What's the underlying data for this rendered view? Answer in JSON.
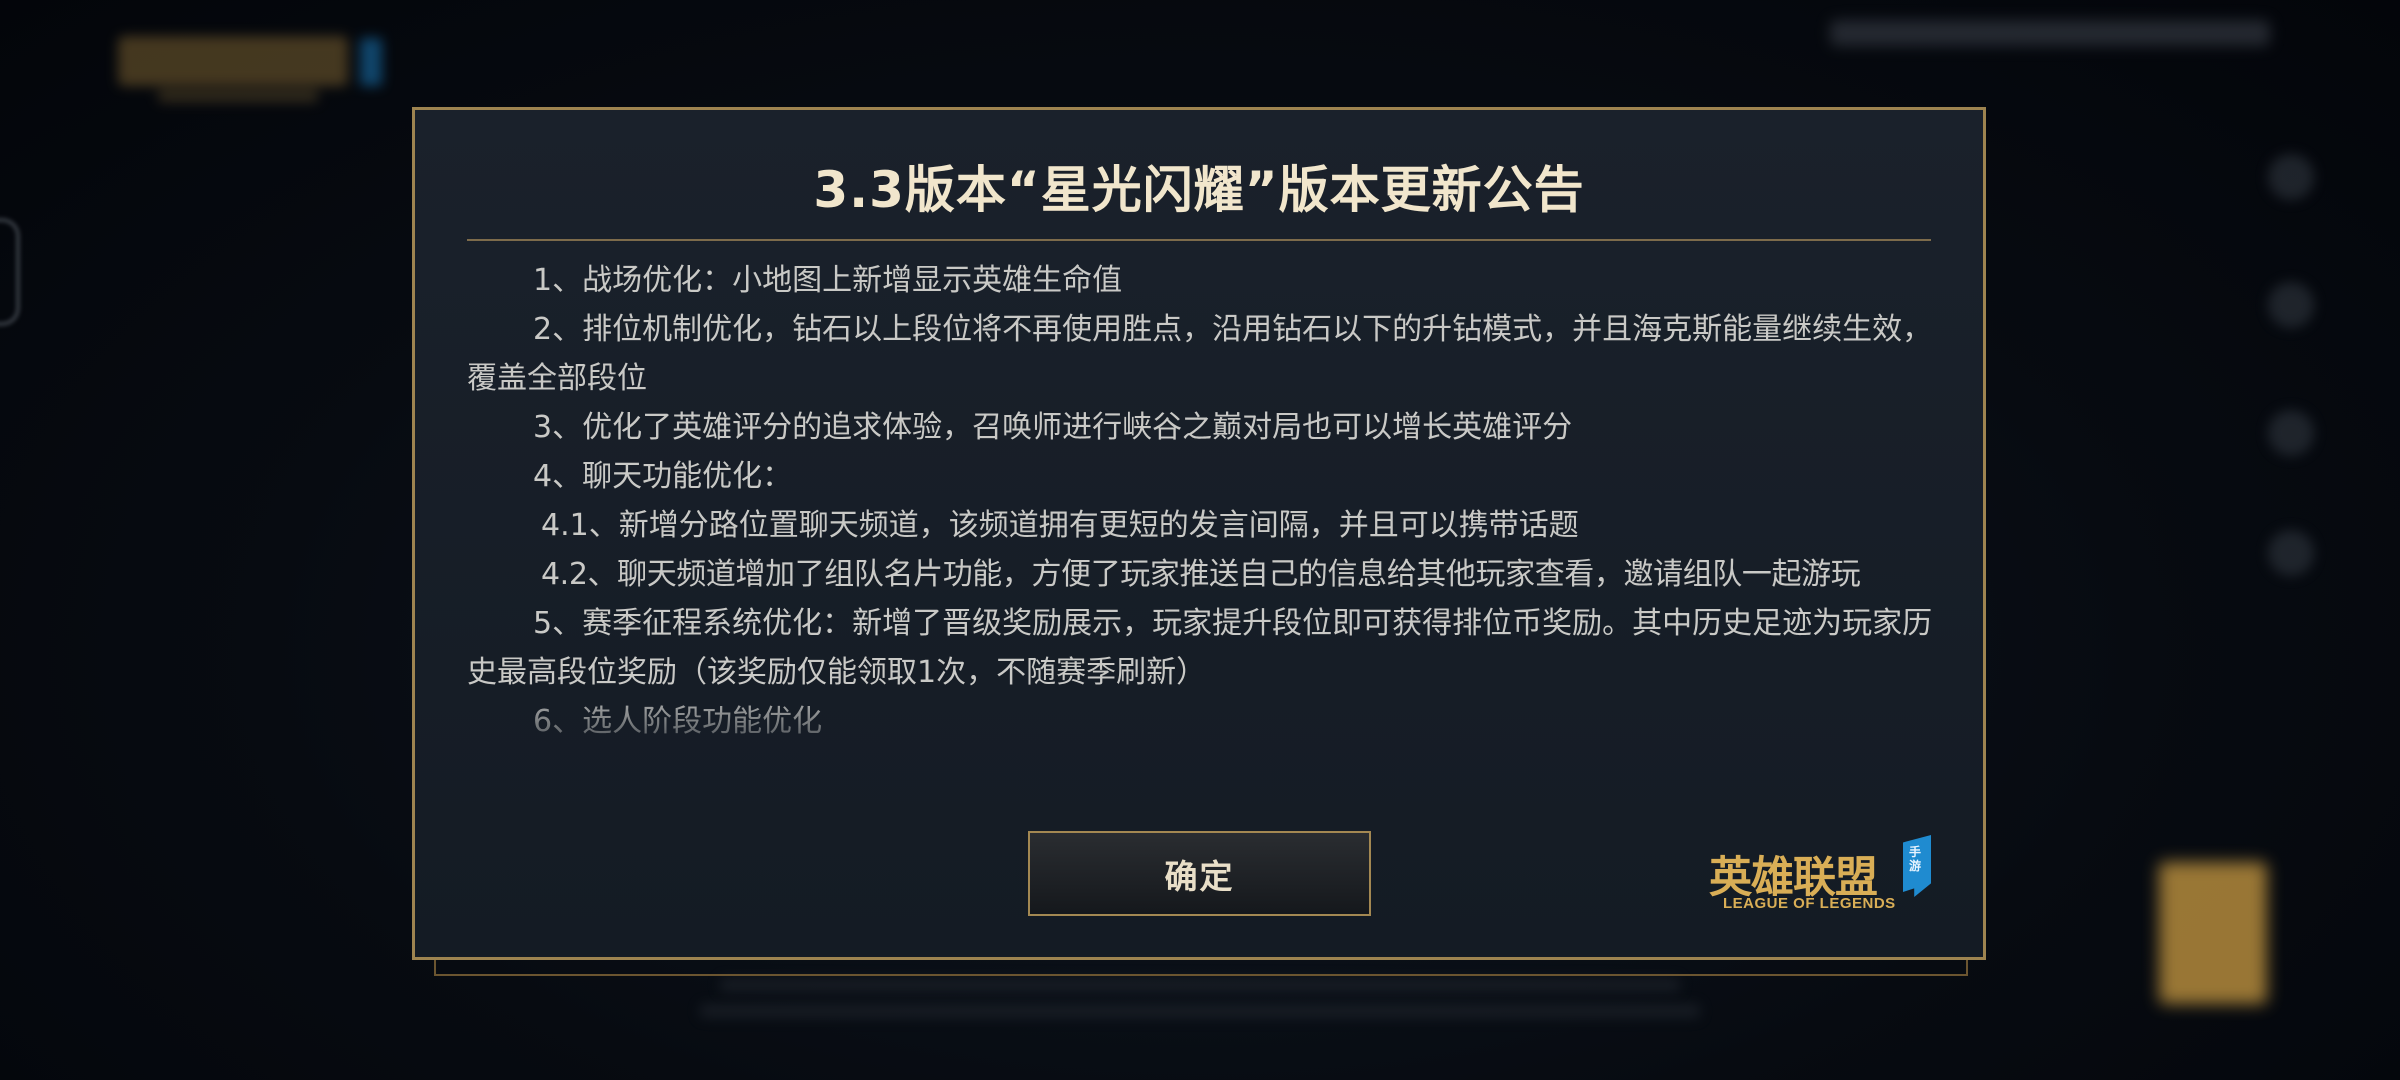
{
  "dialog": {
    "title": "3.3版本“星光闪耀”版本更新公告",
    "paragraphs": [
      "1、战场优化：小地图上新增显示英雄生命值",
      "2、排位机制优化，钻石以上段位将不再使用胜点，沿用钻石以下的升钻模式，并且海克斯能量继续生效，覆盖全部段位",
      "3、优化了英雄评分的追求体验，召唤师进行峡谷之巅对局也可以增长英雄评分",
      "4、聊天功能优化：",
      "4.1、新增分路位置聊天频道，该频道拥有更短的发言间隔，并且可以携带话题",
      "4.2、聊天频道增加了组队名片功能，方便了玩家推送自己的信息给其他玩家查看，邀请组队一起游玩",
      "5、赛季征程系统优化：新增了晋级奖励展示，玩家提升段位即可获得排位币奖励。其中历史足迹为玩家历史最高段位奖励（该奖励仅能领取1次，不随赛季刷新）",
      "6、选人阶段功能优化"
    ],
    "confirm_label": "确定"
  },
  "brand": {
    "cn": "英雄联盟",
    "en": "LEAGUE OF LEGENDS",
    "flag": "手游"
  },
  "colors": {
    "gold_border": "#9e8450",
    "title": "#f1e6cc",
    "body_text": "#c9c9c6",
    "brand_gold": "#d9ae56",
    "brand_blue": "#1f8bd0"
  }
}
